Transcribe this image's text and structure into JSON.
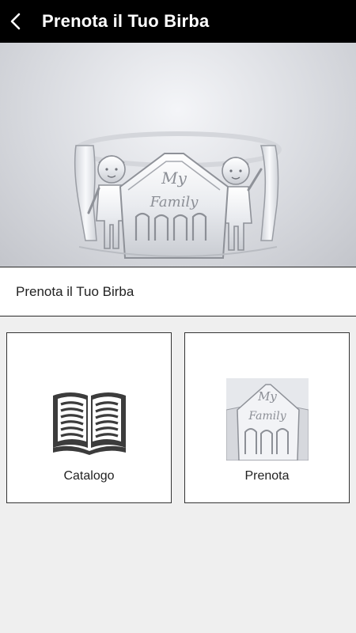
{
  "appbar": {
    "title": "Prenota il Tuo Birba",
    "back_icon": "chevron-left-icon"
  },
  "hero": {
    "image": "silver-family-bracelet-photo",
    "engraving_text": "My Family"
  },
  "section": {
    "title": "Prenota il Tuo Birba"
  },
  "tiles": [
    {
      "label": "Catalogo",
      "icon": "open-book-icon"
    },
    {
      "label": "Prenota",
      "icon": "bracelet-thumbnail",
      "engraving_text": "My Family"
    }
  ],
  "colors": {
    "appbar_bg": "#000000",
    "page_bg": "#efefef",
    "tile_bg": "#ffffff",
    "icon_dark": "#3c3c3c"
  }
}
